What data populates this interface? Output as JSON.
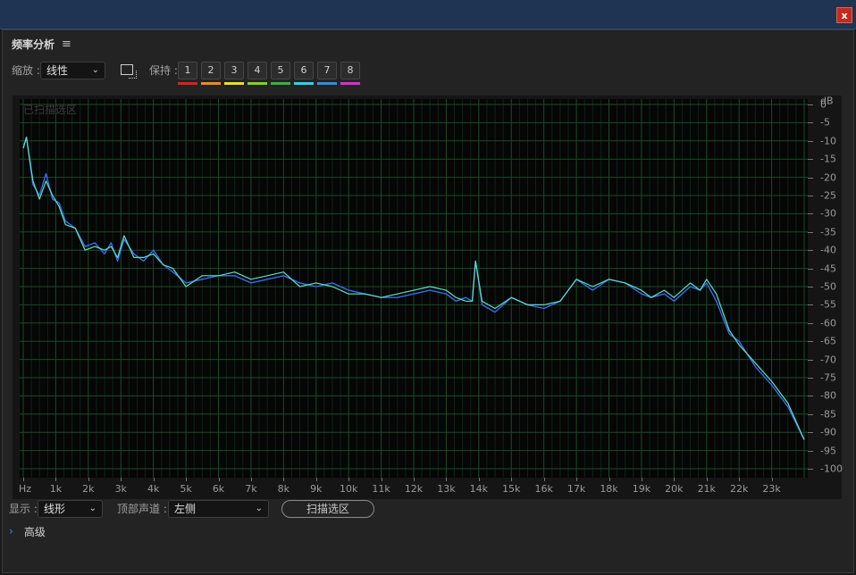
{
  "window": {
    "close_label": "x"
  },
  "panel": {
    "title": "频率分析",
    "menu_icon": "hamburger-menu-icon"
  },
  "toolbar": {
    "zoom_label": "缩放 :",
    "zoom_value": "线性",
    "select_icon": "select-region-icon",
    "hold_label": "保持 :",
    "holds": [
      {
        "label": "1",
        "color": "#e0201b"
      },
      {
        "label": "2",
        "color": "#f28a14"
      },
      {
        "label": "3",
        "color": "#e8e020"
      },
      {
        "label": "4",
        "color": "#7ad61e"
      },
      {
        "label": "5",
        "color": "#34b43c"
      },
      {
        "label": "6",
        "color": "#22d8e8"
      },
      {
        "label": "7",
        "color": "#2e8ee8"
      },
      {
        "label": "8",
        "color": "#e02ad8"
      }
    ]
  },
  "graph": {
    "overlay_text": "已扫描选区",
    "y_unit": "dB",
    "y_ticks": [
      "0",
      "-5",
      "-10",
      "-15",
      "-20",
      "-25",
      "-30",
      "-35",
      "-40",
      "-45",
      "-50",
      "-55",
      "-60",
      "-65",
      "-70",
      "-75",
      "-80",
      "-85",
      "-90",
      "-95",
      "-100"
    ],
    "x_ticks": [
      "Hz",
      "1k",
      "2k",
      "3k",
      "4k",
      "5k",
      "6k",
      "7k",
      "8k",
      "9k",
      "10k",
      "11k",
      "12k",
      "13k",
      "14k",
      "15k",
      "16k",
      "17k",
      "18k",
      "19k",
      "20k",
      "21k",
      "22k",
      "23k"
    ]
  },
  "chart_data": {
    "type": "line",
    "xlabel": "",
    "ylabel": "",
    "xlim": [
      0,
      24000
    ],
    "ylim": [
      -100,
      0
    ],
    "grid": true,
    "series": [
      {
        "color": "#3a6cf0",
        "x": [
          0,
          100,
          300,
          500,
          700,
          900,
          1100,
          1300,
          1600,
          1900,
          2200,
          2500,
          2700,
          2900,
          3100,
          3400,
          3700,
          4000,
          4300,
          4600,
          5000,
          5500,
          6000,
          6500,
          7000,
          7500,
          8000,
          8500,
          9000,
          9500,
          10000,
          10500,
          11000,
          11500,
          12000,
          12500,
          13000,
          13300,
          13600,
          13800,
          13900,
          14100,
          14500,
          15000,
          15500,
          16000,
          16500,
          17000,
          17500,
          18000,
          18500,
          19000,
          19300,
          19700,
          20000,
          20500,
          20800,
          21000,
          21300,
          21700,
          22000,
          22500,
          23000,
          23500,
          24000
        ],
        "y": [
          -12,
          -9,
          -22,
          -25,
          -19,
          -26,
          -27,
          -32,
          -34,
          -39,
          -38,
          -41,
          -38,
          -43,
          -37,
          -41,
          -43,
          -40,
          -44,
          -46,
          -49,
          -48,
          -47,
          -47,
          -49,
          -48,
          -47,
          -49,
          -50,
          -49,
          -51,
          -52,
          -53,
          -53,
          -52,
          -51,
          -52,
          -54,
          -53,
          -54,
          -43,
          -55,
          -57,
          -53,
          -55,
          -56,
          -54,
          -48,
          -51,
          -48,
          -49,
          -52,
          -53,
          -52,
          -54,
          -50,
          -51,
          -49,
          -54,
          -63,
          -65,
          -72,
          -77,
          -83,
          -92
        ]
      },
      {
        "color": "#5ee0c4",
        "x": [
          0,
          100,
          300,
          500,
          700,
          900,
          1100,
          1300,
          1600,
          1900,
          2200,
          2500,
          2700,
          2900,
          3100,
          3400,
          3700,
          4000,
          4300,
          4600,
          5000,
          5500,
          6000,
          6500,
          7000,
          7500,
          8000,
          8500,
          9000,
          9500,
          10000,
          10500,
          11000,
          11500,
          12000,
          12500,
          13000,
          13300,
          13600,
          13800,
          13900,
          14100,
          14500,
          15000,
          15500,
          16000,
          16500,
          17000,
          17500,
          18000,
          18500,
          19000,
          19300,
          19700,
          20000,
          20500,
          20800,
          21000,
          21300,
          21700,
          22000,
          22500,
          23000,
          23500,
          24000
        ],
        "y": [
          -12,
          -9,
          -21,
          -26,
          -21,
          -25,
          -28,
          -33,
          -34,
          -40,
          -39,
          -40,
          -39,
          -42,
          -36,
          -42,
          -42,
          -41,
          -44,
          -45,
          -50,
          -47,
          -47,
          -46,
          -48,
          -47,
          -46,
          -50,
          -49,
          -50,
          -52,
          -52,
          -53,
          -52,
          -51,
          -50,
          -51,
          -53,
          -54,
          -54,
          -43,
          -54,
          -56,
          -53,
          -55,
          -55,
          -54,
          -48,
          -50,
          -48,
          -49,
          -51,
          -53,
          -51,
          -53,
          -49,
          -51,
          -48,
          -52,
          -62,
          -66,
          -71,
          -76,
          -82,
          -92
        ]
      }
    ]
  }
}
